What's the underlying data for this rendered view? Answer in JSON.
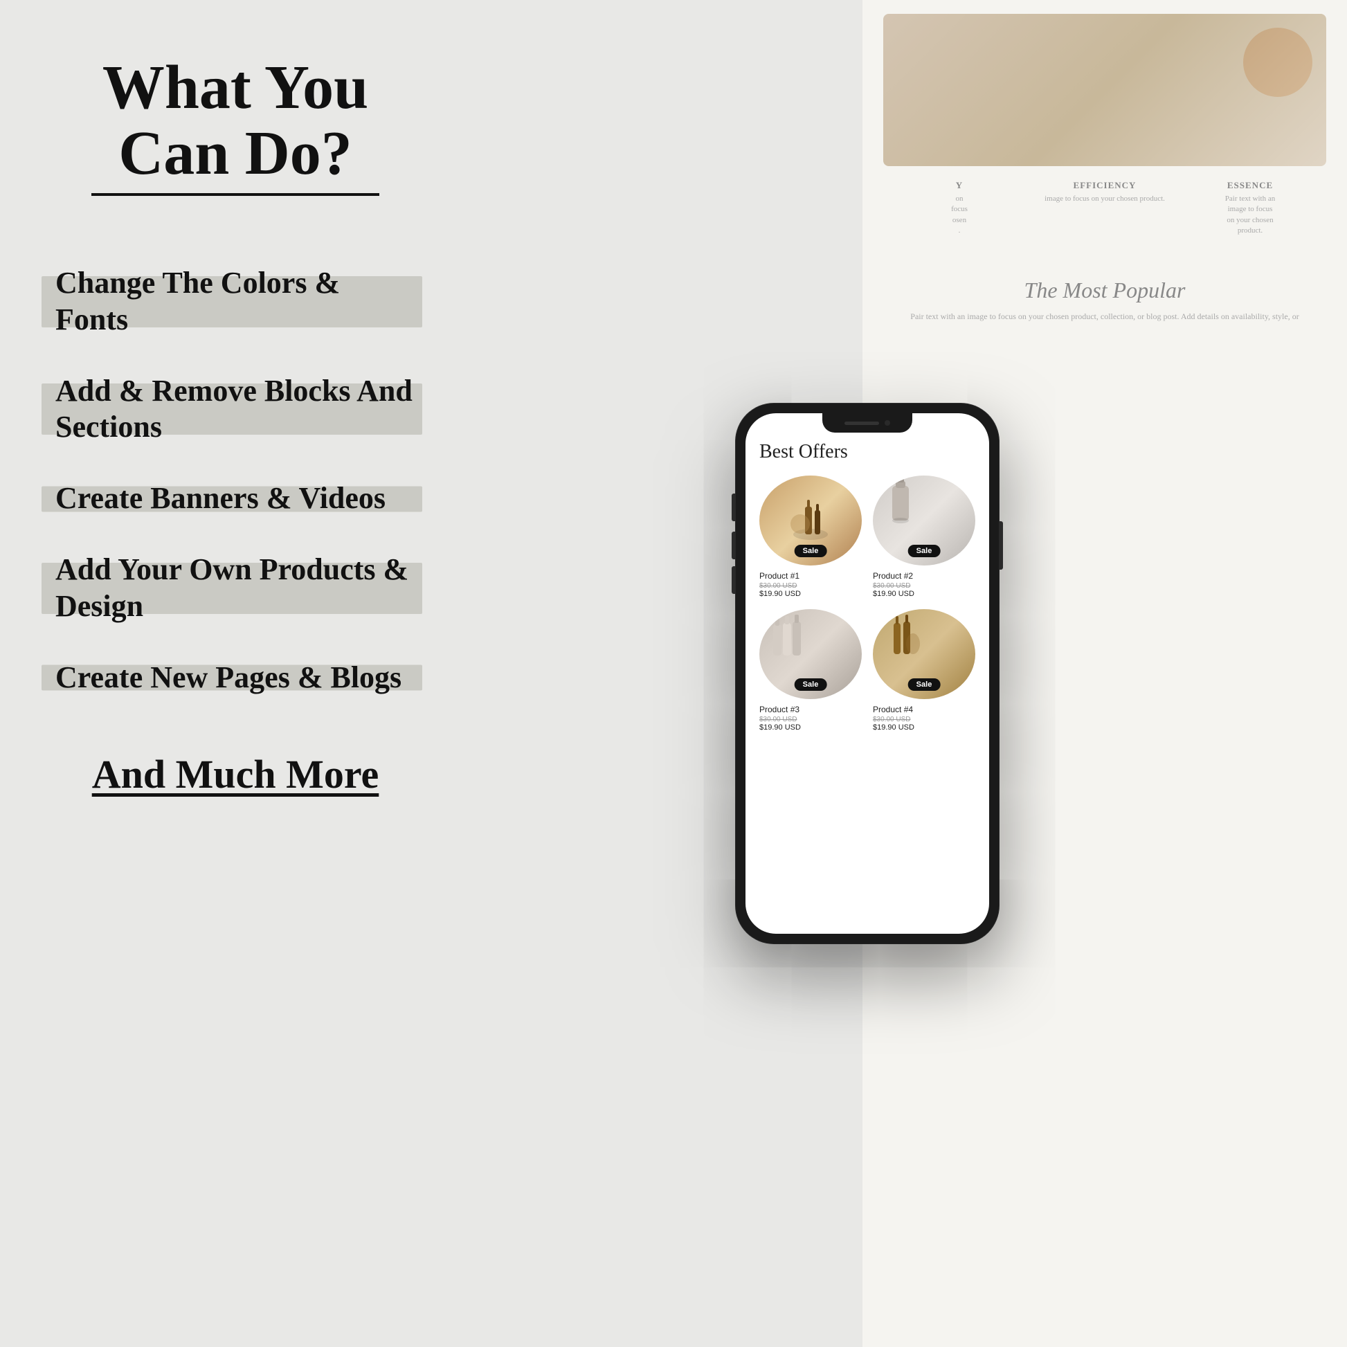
{
  "page": {
    "background_color": "#e8e8e6",
    "title": "What You Can Do?"
  },
  "left": {
    "title": "What You Can Do?",
    "features": [
      {
        "id": "colors-fonts",
        "text": "Change The Colors & Fonts"
      },
      {
        "id": "blocks-sections",
        "text": "Add & Remove Blocks And Sections"
      },
      {
        "id": "banners-videos",
        "text": "Create Banners & Videos"
      },
      {
        "id": "products-design",
        "text": "Add Your Own Products & Design"
      },
      {
        "id": "pages-blogs",
        "text": "Create New Pages & Blogs"
      }
    ],
    "and_more_label": "And Much More"
  },
  "right": {
    "strip": {
      "column_headers": [
        {
          "title": "Y",
          "desc": "on\nfocus\nosen\n."
        },
        {
          "title": "EFFICIENCY",
          "desc": "image to focus\non your chosen\nproduct."
        },
        {
          "title": "ESSENCE",
          "desc": "Pair text with an\nimage to focus\non your chosen\nproduct."
        }
      ],
      "bottom_title": "The Most Popular",
      "bottom_desc": "Pair text with an image to focus on your chosen product, collection, or blog post. Add details on availability, style, or"
    },
    "phone": {
      "section_title": "Best Offers",
      "products": [
        {
          "id": 1,
          "name": "Product #1",
          "price_old": "$30.00 USD",
          "price_new": "$19.90 USD",
          "badge": "Sale",
          "image_type": "amber-bottles"
        },
        {
          "id": 2,
          "name": "Product #2",
          "price_old": "$30.00 USD",
          "price_new": "$19.90 USD",
          "badge": "Sale",
          "image_type": "dispenser"
        },
        {
          "id": 3,
          "name": "Product #3",
          "price_old": "$30.00 USD",
          "price_new": "$19.90 USD",
          "badge": "Sale",
          "image_type": "spray-bottles"
        },
        {
          "id": 4,
          "name": "Product #4",
          "price_old": "$30.00 USD",
          "price_new": "$19.90 USD",
          "badge": "Sale",
          "image_type": "dropper-bottles"
        }
      ]
    }
  }
}
